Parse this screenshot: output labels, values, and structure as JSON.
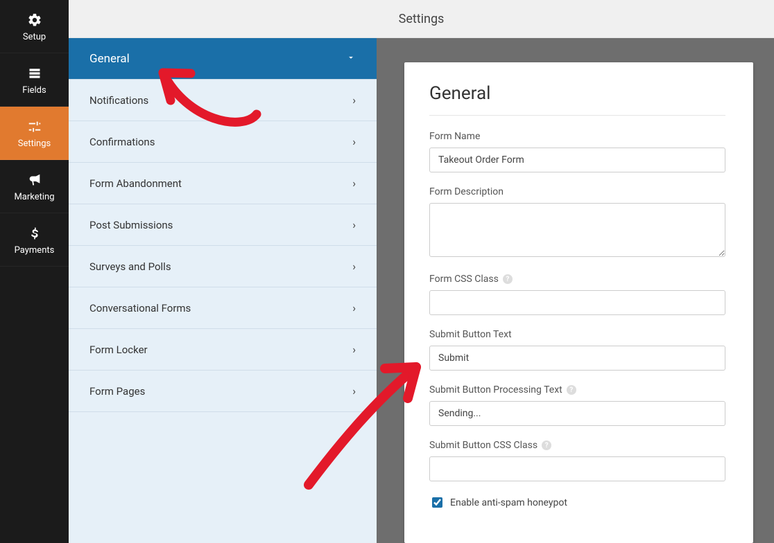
{
  "nav": {
    "items": [
      {
        "label": "Setup"
      },
      {
        "label": "Fields"
      },
      {
        "label": "Settings"
      },
      {
        "label": "Marketing"
      },
      {
        "label": "Payments"
      }
    ]
  },
  "header": {
    "title": "Settings"
  },
  "settings_menu": {
    "items": [
      {
        "label": "General"
      },
      {
        "label": "Notifications"
      },
      {
        "label": "Confirmations"
      },
      {
        "label": "Form Abandonment"
      },
      {
        "label": "Post Submissions"
      },
      {
        "label": "Surveys and Polls"
      },
      {
        "label": "Conversational Forms"
      },
      {
        "label": "Form Locker"
      },
      {
        "label": "Form Pages"
      }
    ]
  },
  "panel": {
    "title": "General",
    "form_name": {
      "label": "Form Name",
      "value": "Takeout Order Form"
    },
    "form_description": {
      "label": "Form Description",
      "value": ""
    },
    "form_css_class": {
      "label": "Form CSS Class",
      "value": ""
    },
    "submit_text": {
      "label": "Submit Button Text",
      "value": "Submit"
    },
    "submit_processing": {
      "label": "Submit Button Processing Text",
      "value": "Sending..."
    },
    "submit_css_class": {
      "label": "Submit Button CSS Class",
      "value": ""
    },
    "honeypot": {
      "label": "Enable anti-spam honeypot",
      "checked": true
    }
  }
}
